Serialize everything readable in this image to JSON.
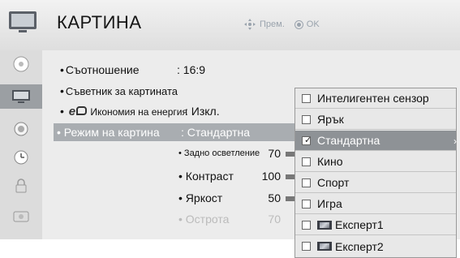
{
  "header": {
    "title": "КАРТИНА",
    "move_label": "Прем.",
    "ok_label": "OK"
  },
  "sidebar": {
    "items": [
      {
        "name": "sidebar-item-setup",
        "icon": "disc-icon"
      },
      {
        "name": "sidebar-item-picture",
        "icon": "tv-icon",
        "active": true
      },
      {
        "name": "sidebar-item-audio",
        "icon": "speaker-icon"
      },
      {
        "name": "sidebar-item-time",
        "icon": "clock-icon"
      },
      {
        "name": "sidebar-item-lock",
        "icon": "lock-icon"
      },
      {
        "name": "sidebar-item-options",
        "icon": "options-icon"
      }
    ]
  },
  "menu": {
    "aspect": {
      "label": "Съотношение",
      "value": ": 16:9"
    },
    "wizard": {
      "label": "Съветник за картината"
    },
    "energy": {
      "label": "Икономия на енергия",
      "value": ": Изкл.",
      "logo": "e"
    },
    "mode": {
      "label": "Режим на картина",
      "value": ": Стандартна"
    },
    "backlight": {
      "label": "Задно осветление",
      "value": "70"
    },
    "contrast": {
      "label": "Контраст",
      "value": "100"
    },
    "brightness": {
      "label": "Яркост",
      "value": "50"
    },
    "sharpness": {
      "label": "Острота",
      "value": "70"
    }
  },
  "dropdown": {
    "items": [
      {
        "label": "Интелигентен сензор",
        "checked": false
      },
      {
        "label": "Ярък",
        "checked": false
      },
      {
        "label": "Стандартна",
        "checked": true
      },
      {
        "label": "Кино",
        "checked": false
      },
      {
        "label": "Спорт",
        "checked": false
      },
      {
        "label": "Игра",
        "checked": false
      },
      {
        "label": "Експерт1",
        "checked": false,
        "expert": true
      },
      {
        "label": "Експерт2",
        "checked": false,
        "expert": true
      }
    ],
    "selected_index": 2
  },
  "colors": {
    "accent": "#8e9296",
    "selected_row": "#a9adb1",
    "sidebar_active": "#9b9fa3"
  }
}
